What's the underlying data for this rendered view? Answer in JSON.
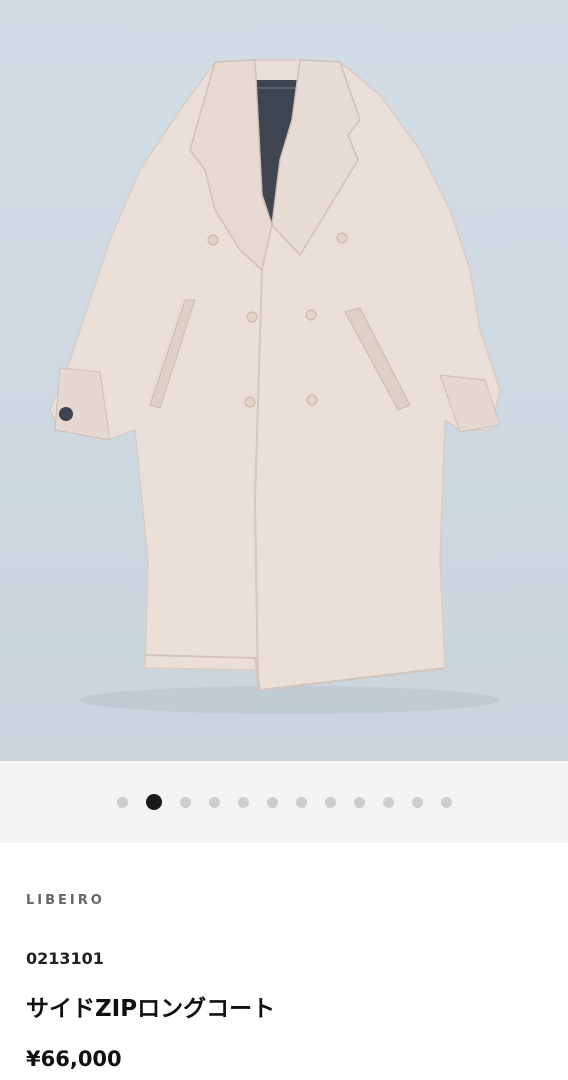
{
  "gallery": {
    "image_alt": "coat-photo",
    "slide_count": 12,
    "active_index": 1
  },
  "product": {
    "brand": "LIBEIRO",
    "code": "0213101",
    "name": "サイドZIPロングコート",
    "price": "¥66,000"
  },
  "colors": {
    "coat": "#ece2dc",
    "background": "#d1dbe4",
    "dot_inactive": "#cdcdcd",
    "dot_active": "#1a1a1a"
  }
}
